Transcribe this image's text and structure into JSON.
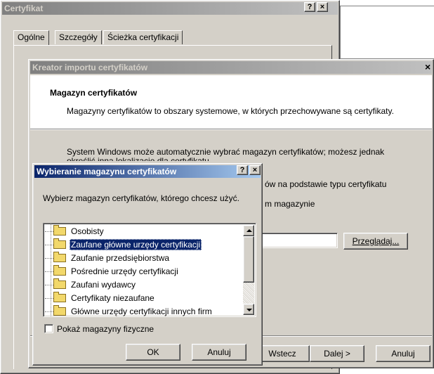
{
  "back_window": {
    "title": "Certyfikat",
    "tabs": [
      "Ogólne",
      "Szczegóły",
      "Ścieżka certyfikacji"
    ]
  },
  "wizard": {
    "title": "Kreator importu certyfikatów",
    "heading": "Magazyn certyfikatów",
    "description": "Magazyny certyfikatów to obszary systemowe, w których przechowywane są certyfikaty.",
    "body_line1": "System Windows może automatycznie wybrać magazyn certyfikatów; możesz jednak",
    "body_line2": "określić inną lokalizację dla certyfikatu.",
    "option1_tail": "ów na podstawie typu certyfikatu",
    "option2_tail": "m magazynie",
    "browse_button": "Przeglądaj...",
    "back_button": "Wstecz",
    "next_button": "Dalej >",
    "cancel_button": "Anuluj"
  },
  "dialog": {
    "title": "Wybieranie magazynu certyfikatów",
    "prompt": "Wybierz magazyn certyfikatów, którego chcesz użyć.",
    "tree_items": [
      "Osobisty",
      "Zaufane główne urzędy certyfikacji",
      "Zaufanie przedsiębiorstwa",
      "Pośrednie urzędy certyfikacji",
      "Zaufani wydawcy",
      "Certyfikaty niezaufane",
      "Główne urzędy certyfikacji innych firm"
    ],
    "selected_index": 1,
    "checkbox_label": "Pokaż magazyny fizyczne",
    "checkbox_checked": false,
    "ok_button": "OK",
    "cancel_button": "Anuluj"
  },
  "title_buttons": {
    "help": "?",
    "close": "×"
  }
}
